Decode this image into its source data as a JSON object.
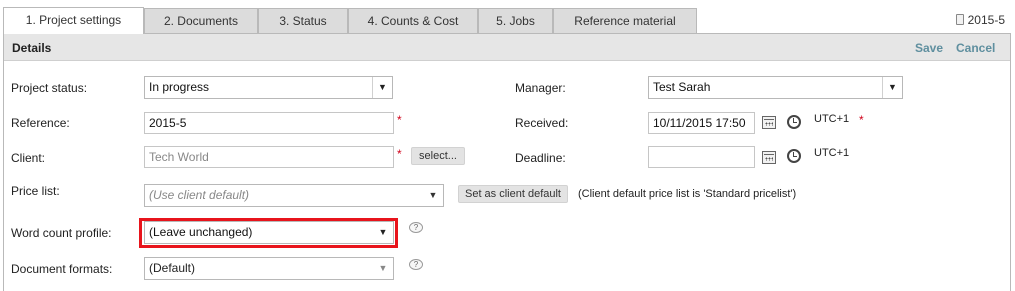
{
  "tabs": [
    {
      "label": "1. Project settings",
      "active": true
    },
    {
      "label": "2. Documents",
      "active": false
    },
    {
      "label": "3. Status",
      "active": false
    },
    {
      "label": "4. Counts & Cost",
      "active": false
    },
    {
      "label": "5. Jobs",
      "active": false
    },
    {
      "label": "Reference material",
      "active": false
    }
  ],
  "project_id": "2015-5",
  "panel": {
    "title": "Details",
    "save_label": "Save",
    "cancel_label": "Cancel"
  },
  "form": {
    "project_status": {
      "label": "Project status:",
      "value": "In progress"
    },
    "reference": {
      "label": "Reference:",
      "value": "2015-5",
      "required": "*"
    },
    "client": {
      "label": "Client:",
      "value": "Tech World",
      "required": "*",
      "select_button": "select..."
    },
    "price_list": {
      "label": "Price list:",
      "value": "(Use client default)",
      "default_button": "Set as client default",
      "note": "(Client default price list is 'Standard pricelist')"
    },
    "word_count_profile": {
      "label": "Word count profile:",
      "value": "(Leave unchanged)"
    },
    "document_formats": {
      "label": "Document formats:",
      "value": "(Default)"
    },
    "manager": {
      "label": "Manager:",
      "value": "Test Sarah"
    },
    "received": {
      "label": "Received:",
      "value": "10/11/2015 17:50",
      "timezone": "UTC+1",
      "required": "*"
    },
    "deadline": {
      "label": "Deadline:",
      "value": "",
      "timezone": "UTC+1"
    }
  },
  "colors": {
    "accent": "#5f8f9f",
    "required": "#d0021b",
    "highlight": "#e8141c"
  },
  "icons": [
    "document-icon",
    "calendar-icon",
    "clock-icon",
    "help-bubble-icon",
    "dropdown-arrow-icon"
  ]
}
